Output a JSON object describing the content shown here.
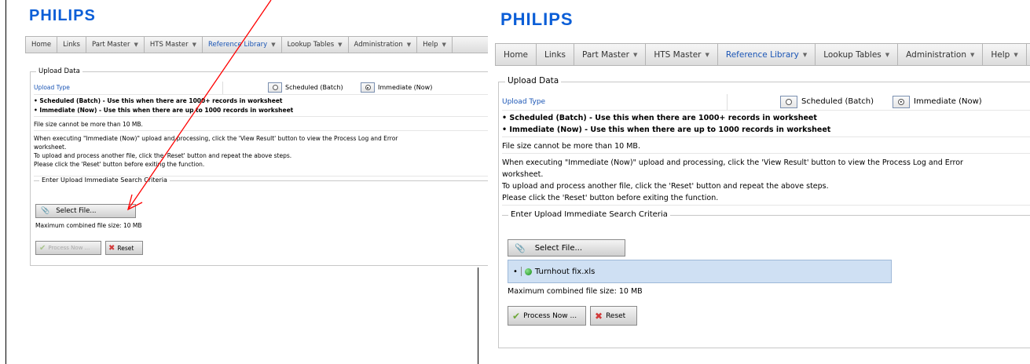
{
  "brand": "PHILIPS",
  "nav": [
    {
      "label": "Home",
      "dropdown": false,
      "active": false
    },
    {
      "label": "Links",
      "dropdown": false,
      "active": false
    },
    {
      "label": "Part Master",
      "dropdown": true,
      "active": false
    },
    {
      "label": "HTS Master",
      "dropdown": true,
      "active": false
    },
    {
      "label": "Reference Library",
      "dropdown": true,
      "active": true
    },
    {
      "label": "Lookup Tables",
      "dropdown": true,
      "active": false
    },
    {
      "label": "Administration",
      "dropdown": true,
      "active": false
    },
    {
      "label": "Help",
      "dropdown": true,
      "active": false
    }
  ],
  "upload": {
    "section_title": "Upload Data",
    "type_label": "Upload Type",
    "option_scheduled": "Scheduled (Batch)",
    "option_immediate": "Immediate (Now)",
    "selected": "Immediate (Now)",
    "bullet_scheduled": "Scheduled (Batch) - Use this when there are 1000+ records in worksheet",
    "bullet_immediate": "Immediate (Now) - Use this when there are up to 1000 records in worksheet",
    "size_note": "File size cannot be more than 10 MB.",
    "instr_1": "When executing \"Immediate (Now)\" upload and processing, click the 'View Result' button to view the Process Log and Error",
    "instr_1b": "worksheet.",
    "instr_2": "To upload and process another file, click the 'Reset' button and repeat the above steps.",
    "instr_3": "Please click the 'Reset' button before exiting the function.",
    "criteria_title": "Enter Upload Immediate Search Criteria",
    "select_file_label": "Select File...",
    "max_size": "Maximum combined file size: 10 MB",
    "process_now_label": "Process Now ...",
    "reset_label": "Reset",
    "uploaded_file": "Turnhout fix.xls"
  },
  "colors": {
    "brand_blue": "#0b5ed7",
    "annotation_arrow": "#ff0000",
    "file_item_bg": "#cfe0f3"
  }
}
